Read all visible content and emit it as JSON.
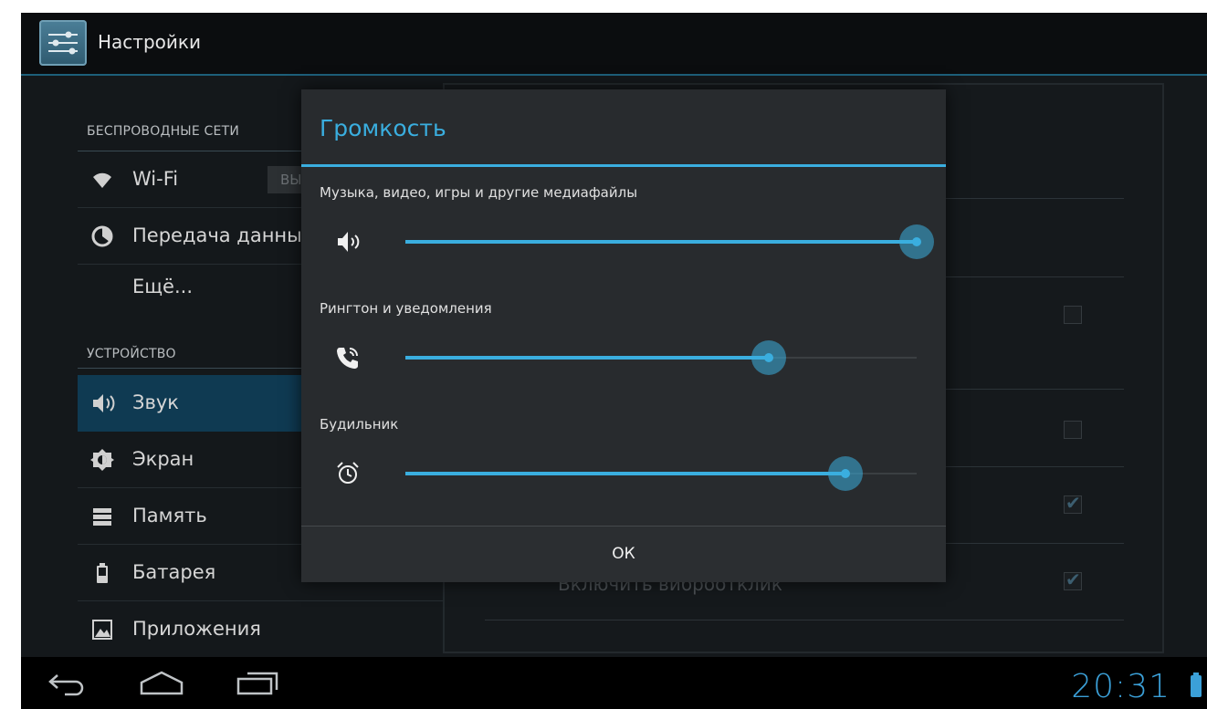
{
  "app": {
    "title": "Настройки",
    "icon": "settings-sliders-icon"
  },
  "sections": {
    "wireless": "БЕСПРОВОДНЫЕ СЕТИ",
    "device": "УСТРОЙСТВО"
  },
  "nav": {
    "wifi": {
      "label": "Wi-Fi",
      "icon": "wifi-icon",
      "toggle": "ВЫ"
    },
    "data": {
      "label": "Передача данных",
      "icon": "data-usage-icon"
    },
    "more": {
      "label": "Ещё..."
    },
    "sound": {
      "label": "Звук",
      "icon": "speaker-icon",
      "selected": true
    },
    "display": {
      "label": "Экран",
      "icon": "brightness-icon"
    },
    "storage": {
      "label": "Память",
      "icon": "storage-icon"
    },
    "battery": {
      "label": "Батарея",
      "icon": "battery-icon"
    },
    "apps": {
      "label": "Приложения",
      "icon": "apps-icon"
    }
  },
  "right_pane": {
    "visible_text": "Включить виброотклик",
    "checkbox_states": [
      false,
      false,
      true,
      true
    ]
  },
  "dialog": {
    "title": "Громкость",
    "sliders": [
      {
        "label": "Музыка, видео, игры и другие медиафайлы",
        "icon": "speaker-icon",
        "level": 1.0
      },
      {
        "label": "Рингтон и уведомления",
        "icon": "phone-ring-icon",
        "level": 0.71
      },
      {
        "label": "Будильник",
        "icon": "alarm-clock-icon",
        "level": 0.86
      }
    ],
    "ok_label": "ОК"
  },
  "statusbar": {
    "time": "20:31"
  },
  "colors": {
    "accent": "#3aaedf",
    "selected": "#0f3a52",
    "background": "#14181b"
  }
}
